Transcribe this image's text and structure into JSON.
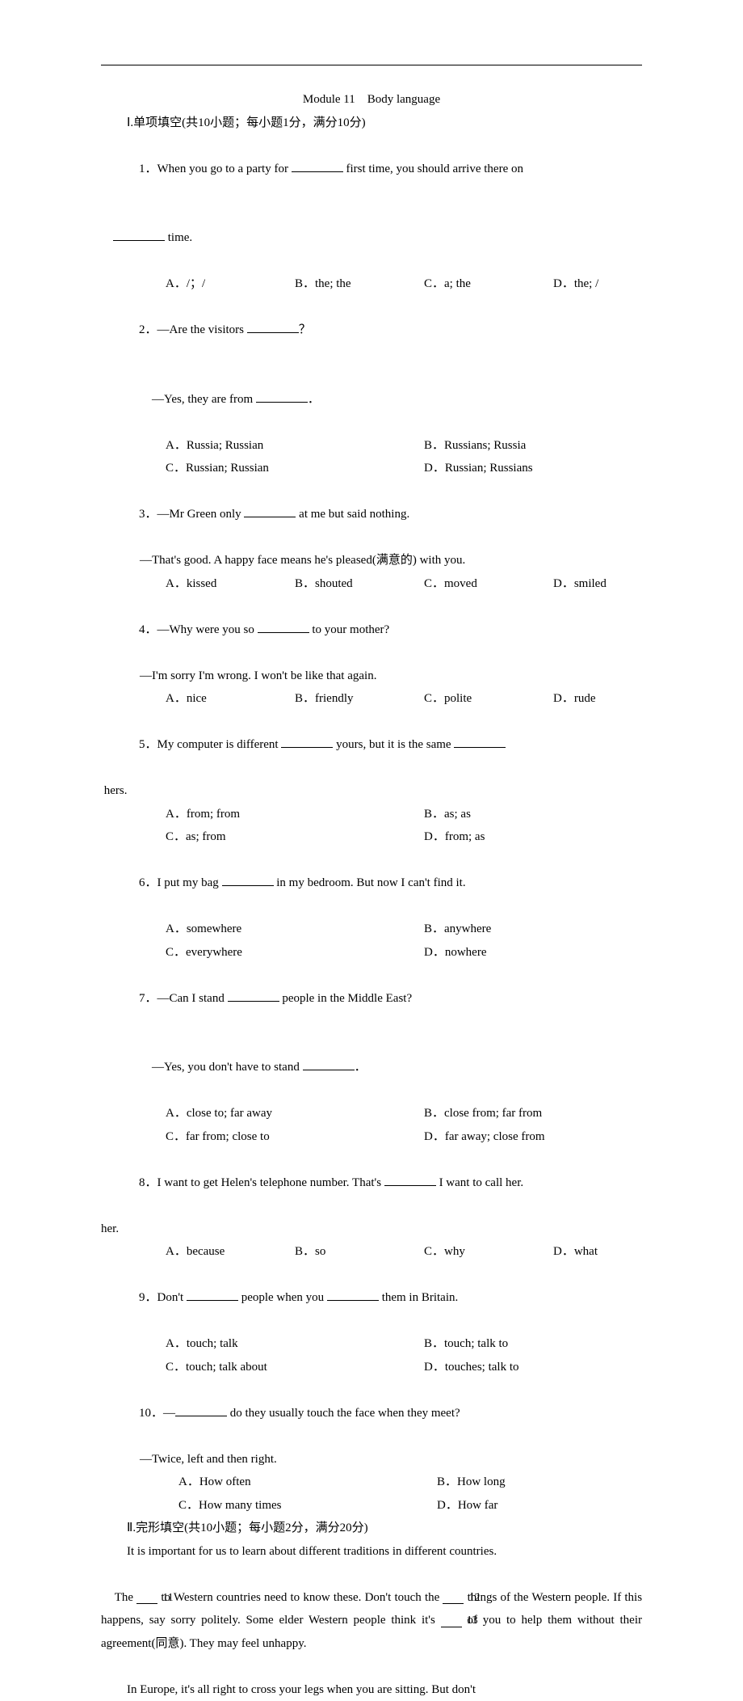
{
  "title": "Module 11　Body language",
  "section1_header": "Ⅰ.单项填空(共10小题；每小题1分，满分10分)",
  "q1_a": "1．When you go to a party for ",
  "q1_b": " first time, you should arrive there on ",
  "q1_c": " time.",
  "q1_opts": {
    "a": "A．/；/",
    "b": "B．the; the",
    "c": "C．a; the",
    "d": "D．the; /"
  },
  "q2_a": "2．—Are the visitors ",
  "q2_b": "？",
  "q2_c": "—Yes, they are from ",
  "q2_d": "．",
  "q2_opts": {
    "a": "A．Russia; Russian",
    "b": "B．Russians; Russia",
    "c": "C．Russian; Russian",
    "d": "D．Russian; Russians"
  },
  "q3_a": "3．—Mr Green only ",
  "q3_b": " at me but said nothing.",
  "q3_c": "—That's good. A happy face means he's pleased(满意的) with you.",
  "q3_opts": {
    "a": "A．kissed",
    "b": "B．shouted",
    "c": "C．moved",
    "d": "D．smiled"
  },
  "q4_a": "4．—Why were you so ",
  "q4_b": " to your mother?",
  "q4_c": "—I'm sorry I'm wrong. I won't be like that again.",
  "q4_opts": {
    "a": "A．nice",
    "b": "B．friendly",
    "c": "C．polite",
    "d": "D．rude"
  },
  "q5_a": "5．My computer is different ",
  "q5_b": " yours, but it is the same ",
  "q5_c": " hers.",
  "q5_opts": {
    "a": "A．from; from",
    "b": "B．as; as",
    "c": "C．as; from",
    "d": "D．from; as"
  },
  "q6_a": "6．I put my bag ",
  "q6_b": " in my bedroom. But now I can't find it.",
  "q6_opts": {
    "a": "A．somewhere",
    "b": "B．anywhere",
    "c": "C．everywhere",
    "d": "D．nowhere"
  },
  "q7_a": "7．—Can I stand ",
  "q7_b": " people in the Middle East?",
  "q7_c": "—Yes, you don't have to stand ",
  "q7_d": "．",
  "q7_opts": {
    "a": "A．close to; far away",
    "b": "B．close from; far from",
    "c": "C．far from; close to",
    "d": "D．far away; close from"
  },
  "q8_a": "8．I want to get Helen's telephone number. That's ",
  "q8_b": " I want to call her.",
  "q8_opts": {
    "a": "A．because",
    "b": "B．so",
    "c": "C．why",
    "d": "D．what"
  },
  "q9_a": "9．Don't ",
  "q9_b": " people when you ",
  "q9_c": " them in Britain.",
  "q9_opts": {
    "a": "A．touch; talk",
    "b": "B．touch; talk to",
    "c": "C．touch; talk about",
    "d": "D．touches; talk to"
  },
  "q10_a": "10．—",
  "q10_b": " do they usually touch the face when they meet?",
  "q10_c": "—Twice, left and then right.",
  "q10_opts": {
    "a": "A．How often",
    "b": "B．How long",
    "c": "C．How many times",
    "d": "D．How far"
  },
  "section2_header": "Ⅱ.完形填空(共10小题；每小题2分，满分20分)",
  "p1": "It is important for us to learn about different traditions in different countries.",
  "p2_a": "The ",
  "p2_b11": "11",
  "p2_b": " to Western countries need to know these. Don't touch the ",
  "p2_b12": "12",
  "p2_c": " things of the Western people. If this happens, say sorry politely. Some elder Western people think it's ",
  "p2_b13": "13",
  "p2_d": " of you to help them without their agreement(同意). They may feel unhappy.",
  "p3": "In Europe, it's all right to cross your legs when you are sitting. But don't"
}
